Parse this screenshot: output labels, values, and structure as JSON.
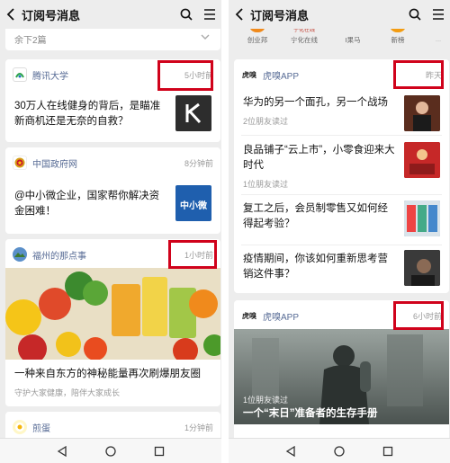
{
  "left": {
    "header": {
      "title": "订阅号消息"
    },
    "collapsed_text": "余下2篇",
    "cards": [
      {
        "source": "腾讯大学",
        "time": "5小时前",
        "title": "30万人在线健身的背后，是瞄准新商机还是无奈的自救？"
      },
      {
        "source": "中国政府网",
        "time": "8分钟前",
        "title": "@中小微企业，国家帮你解决资金困难！",
        "thumb_text": "中小微"
      },
      {
        "source": "福州的那点事",
        "time": "1小时前",
        "title": "一种来自东方的神秘能量再次刷爆朋友圈",
        "subtitle": "守护大家健康，陪伴大家成长"
      },
      {
        "source": "煎蛋",
        "time": "1分钟前"
      }
    ]
  },
  "right": {
    "header": {
      "title": "订阅号消息"
    },
    "top_apps": [
      "创业邦",
      "宁化在线",
      "I果马",
      "新榜",
      "..."
    ],
    "card1": {
      "source": "虎嗅APP",
      "time": "昨天",
      "items": [
        {
          "title": "华为的另一个面孔，另一个战场",
          "sub": "2位朋友读过"
        },
        {
          "title": "良品铺子“云上市”，小零食迎来大时代",
          "sub": "1位朋友读过"
        },
        {
          "title": "复工之后，会员制零售又如何经得起考验？",
          "sub": ""
        },
        {
          "title": "疫情期间，你该如何重新思考营销这件事？",
          "sub": ""
        }
      ]
    },
    "card2": {
      "source": "虎嗅APP",
      "time": "6小时前",
      "readers": "1位朋友读过",
      "title": "一个“末日”准备者的生存手册"
    }
  }
}
